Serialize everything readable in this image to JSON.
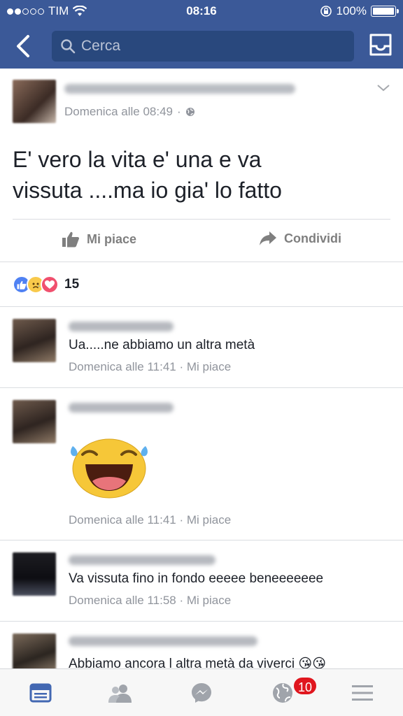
{
  "status_bar": {
    "carrier": "TIM",
    "time": "08:16",
    "battery": "100%"
  },
  "header": {
    "search_placeholder": "Cerca"
  },
  "post": {
    "time": "Domenica alle 08:49",
    "text_line1": "E' vero la  vita e' una e va",
    "text_line2": "vissuta ....ma io gia' lo fatto",
    "like_label": "Mi piace",
    "share_label": "Condividi",
    "reactions_count": "15"
  },
  "comments": [
    {
      "text": "Ua.....ne abbiamo un altra metà",
      "time": "Domenica alle 11:41",
      "like": "Mi piace"
    },
    {
      "text": "",
      "time": "Domenica alle 11:41",
      "like": "Mi piace",
      "sticker": "laughing-sticker"
    },
    {
      "text": "Va vissuta fino in fondo eeeee beneeeeeee",
      "time": "Domenica alle 11:58",
      "like": "Mi piace"
    },
    {
      "text": "Abbiamo ancora l altra metà da viverci 😘😘"
    }
  ],
  "tabbar": {
    "notifications_badge": "10"
  },
  "colors": {
    "brand": "#3b5998",
    "search_bg": "#29487d",
    "meta": "#90949c",
    "badge": "#e0161e"
  },
  "icons": [
    "back-icon",
    "search-icon",
    "inbox-icon",
    "chevron-down-icon",
    "globe-icon",
    "like-icon",
    "share-icon",
    "like-reaction-icon",
    "sad-reaction-icon",
    "love-reaction-icon",
    "news-feed-icon",
    "friends-icon",
    "messenger-icon",
    "notifications-icon",
    "menu-icon"
  ]
}
